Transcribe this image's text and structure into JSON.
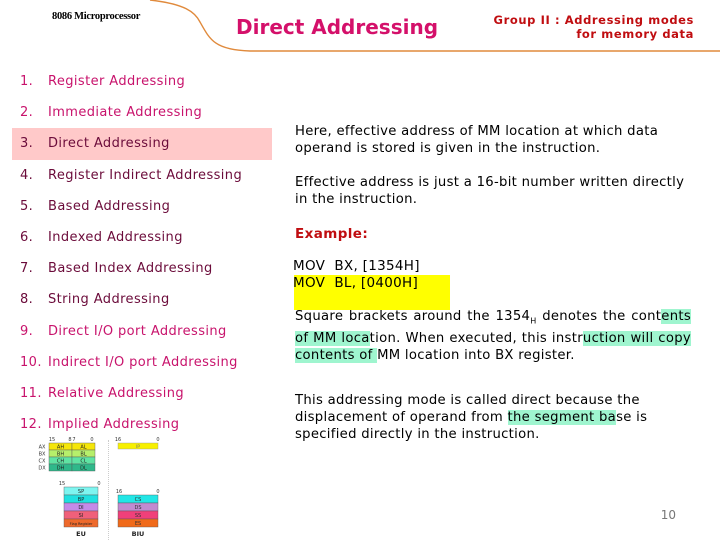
{
  "header": {
    "course": "8086 Microprocessor",
    "title": "Direct Addressing",
    "group_line1": "Group II : Addressing modes",
    "group_line2": "for memory data"
  },
  "modes": [
    {
      "num": "1.",
      "label": "Register Addressing",
      "tone": "magenta"
    },
    {
      "num": "2.",
      "label": "Immediate Addressing",
      "tone": "magenta"
    },
    {
      "num": "3.",
      "label": "Direct Addressing",
      "tone": "dark",
      "selected": true
    },
    {
      "num": "4.",
      "label": "Register Indirect Addressing",
      "tone": "dark"
    },
    {
      "num": "5.",
      "label": "Based Addressing",
      "tone": "dark"
    },
    {
      "num": "6.",
      "label": "Indexed Addressing",
      "tone": "dark"
    },
    {
      "num": "7.",
      "label": "Based Index Addressing",
      "tone": "dark"
    },
    {
      "num": "8.",
      "label": "String Addressing",
      "tone": "dark"
    },
    {
      "num": "9.",
      "label": "Direct I/O port Addressing",
      "tone": "magenta"
    },
    {
      "num": "10.",
      "label": "Indirect I/O port Addressing",
      "tone": "magenta"
    },
    {
      "num": "11.",
      "label": "Relative Addressing",
      "tone": "magenta"
    },
    {
      "num": "12.",
      "label": "Implied Addressing",
      "tone": "magenta"
    }
  ],
  "content": {
    "para1": "Here, effective address of MM location at which data operand is stored is given in the instruction.",
    "para2": "Effective address is just a 16-bit number written directly in the instruction.",
    "example_label": "Example:",
    "code_line1": "MOV  BX, [1354H]",
    "code_line2": "MOV  BL, [0400H]",
    "para3_a": "Square brackets around the 1354",
    "para3_sub": "H",
    "para3_b": " denotes the cont",
    "para3_hl1": "ents of MM loca",
    "para3_c": "tion. When executed, this instr",
    "para3_hl2": "uction will copy contents of ",
    "para3_d": "MM location into BX register.",
    "para4_a": "This addressing mode is called direct because the displacement of operand from ",
    "para4_hl": "the segment ba",
    "para4_b": "se is specified directly in the instruction."
  },
  "diagram": {
    "eu_label": "EU",
    "biu_label": "BIU",
    "gp_bits": [
      "15",
      "8",
      "7",
      "0"
    ],
    "gp_rows": [
      {
        "name": "AX",
        "hi": "AH",
        "lo": "AL",
        "color": "#f5e60a"
      },
      {
        "name": "BX",
        "hi": "BH",
        "lo": "BL",
        "color": "#b6ef6b"
      },
      {
        "name": "CX",
        "hi": "CH",
        "lo": "CL",
        "color": "#5fe3a3"
      },
      {
        "name": "DX",
        "hi": "DH",
        "lo": "DL",
        "color": "#2fb88a"
      }
    ],
    "ip": {
      "bits": [
        "16",
        "0"
      ],
      "label": "IP",
      "color": "#f7f000"
    },
    "eu_bits": [
      "15",
      "0"
    ],
    "eu_regs": [
      {
        "label": "SP",
        "color": "#7ef5f0"
      },
      {
        "label": "BP",
        "color": "#20e0e0"
      },
      {
        "label": "DI",
        "color": "#c58ae8"
      },
      {
        "label": "SI",
        "color": "#f0607a"
      },
      {
        "label": "Flag Register",
        "color": "#ee6a2c"
      }
    ],
    "biu_bits": [
      "16",
      "0"
    ],
    "biu_regs": [
      {
        "label": "CS",
        "color": "#22e6e6"
      },
      {
        "label": "DS",
        "color": "#c28ad0"
      },
      {
        "label": "SS",
        "color": "#f0407a"
      },
      {
        "label": "ES",
        "color": "#f06a1a"
      }
    ]
  },
  "page_number": "10",
  "colors": {
    "title": "#d4106a",
    "group": "#c00d10",
    "selected_bg": "#ffc9c9",
    "code_highlight": "#ffff00",
    "text_highlight": "#9ff5cf",
    "header_curve": "#e08a3c"
  }
}
